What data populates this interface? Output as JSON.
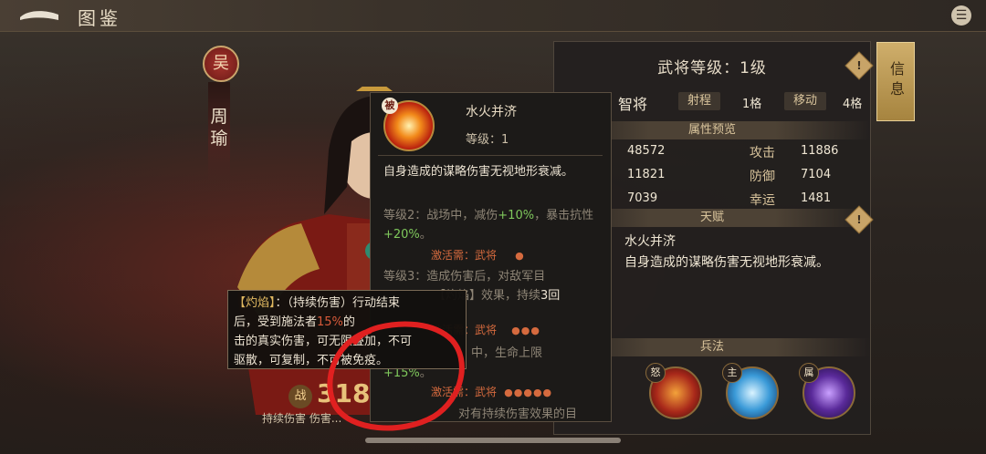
{
  "header": {
    "title": "图鉴"
  },
  "hero": {
    "faction": "吴",
    "name": "周瑜",
    "power_icon_text": "战",
    "power_value": "3187",
    "skill_caption": "持续伤害 伤害..."
  },
  "info_panel": {
    "level_title": "武将等级：1级",
    "type": "智将",
    "range_label": "射程",
    "range_value": "1格",
    "move_label": "移动",
    "move_value": "4格",
    "attr_section": "属性预览",
    "stats": {
      "hp_value": "48572",
      "attack_label": "攻击",
      "attack_value": "11886",
      "stat2_value": "11821",
      "defense_label": "防御",
      "defense_value": "7104",
      "stat3_value": "7039",
      "luck_label": "幸运",
      "luck_value": "1481"
    },
    "talent_section": "天赋",
    "talent_name": "水火并济",
    "talent_desc": "自身造成的谋略伤害无视地形衰减。",
    "tactics_section": "兵法",
    "skill_tags": [
      "怒",
      "主",
      "属"
    ],
    "info_tab_label": "信息"
  },
  "tip_card": {
    "tag": "被",
    "name": "水火并济",
    "level": "等级：1",
    "desc": "自身造成的谋略伤害无视地形衰减。",
    "lv2_prefix": "等级2：战场中，减伤",
    "lv2_val1": "+10%",
    "lv2_mid": "，暴击抗性",
    "lv2_val2": "+20%",
    "lv2_end": "。",
    "lv2_req": "激活需：武将",
    "lv2_dots": "●",
    "lv3_prefix": "等级3：造成伤害后，对敌军目",
    "lv3_mid": "【灼焰】效果，持续",
    "lv3_val": "3回",
    "lv3_req": "激活需：武将",
    "lv3_dots": "●●●",
    "lv4_text": "中，生命上限",
    "lv4_val": "+15%",
    "lv4_end": "。",
    "lv4_req": "激活需：武将",
    "lv4_dots": "●●●●●",
    "lv5_text": "对有持续伤害效果的目"
  },
  "burn_tip": {
    "line1_a": "【灼焰】",
    "line1_b": "：（持续伤害）行动结束",
    "line2_a": "后，受到施法者",
    "line2_b": "15%",
    "line2_c": "的",
    "line3": "击的真实伤害，可无限叠加，不可",
    "line4": "驱散，可复制，不可被免疫。"
  }
}
